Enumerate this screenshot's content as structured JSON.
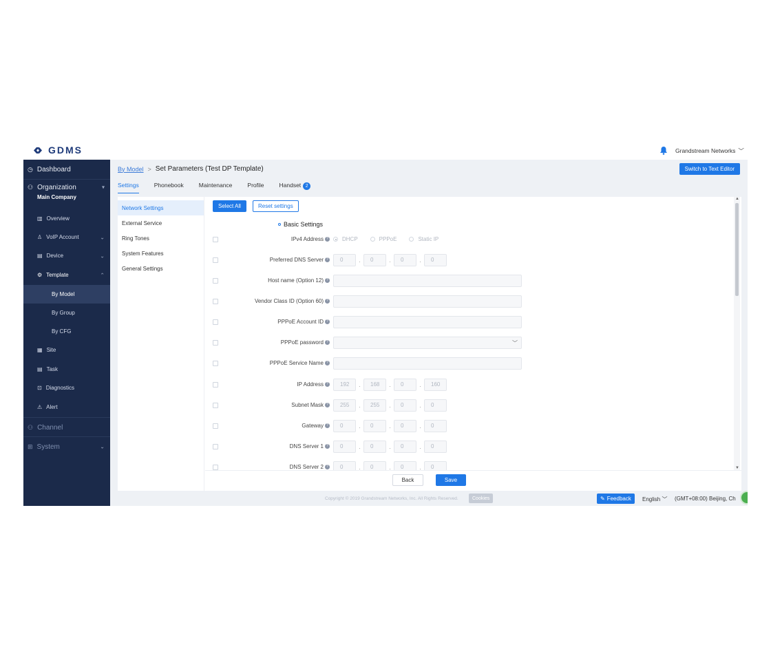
{
  "app": {
    "logo_text": "GDMS",
    "org_name": "Grandstream Networks"
  },
  "sidebar": {
    "dashboard": "Dashboard",
    "organization": "Organization",
    "company": "Main Company",
    "items": [
      "Overview",
      "VoIP Account",
      "Device",
      "Template"
    ],
    "template_children": [
      "By Model",
      "By Group",
      "By CFG"
    ],
    "items2": [
      "Site",
      "Task",
      "Diagnostics",
      "Alert"
    ],
    "channel": "Channel",
    "system": "System"
  },
  "breadcrumb": {
    "link": "By Model",
    "separator": ">",
    "title": "Set Parameters (Test DP Template)"
  },
  "header": {
    "switch_button": "Switch to Text Editor"
  },
  "tabs": [
    {
      "label": "Settings"
    },
    {
      "label": "Phonebook"
    },
    {
      "label": "Maintenance"
    },
    {
      "label": "Profile"
    },
    {
      "label": "Handset",
      "badge": "2"
    }
  ],
  "subnav": [
    "Network Settings",
    "External Service",
    "Ring Tones",
    "System Features",
    "General Settings"
  ],
  "content": {
    "select_all": "Select All",
    "reset": "Reset settings",
    "section_title": "Basic Settings",
    "ipv4_label": "IPv4 Address",
    "ipv4_options": [
      "DHCP",
      "PPPoE",
      "Static IP"
    ],
    "dns_label": "Preferred DNS Server",
    "dns_values": [
      "0",
      "0",
      "0",
      "0"
    ],
    "host_label": "Host name (Option 12)",
    "vendor_label": "Vendor Class ID (Option 60)",
    "pppoe_account_label": "PPPoE Account ID",
    "pppoe_password_label": "PPPoE password",
    "pppoe_service_label": "PPPoE Service Name",
    "ip_label": "IP Address",
    "ip_values": [
      "192",
      "168",
      "0",
      "160"
    ],
    "mask_label": "Subnet Mask",
    "mask_values": [
      "255",
      "255",
      "0",
      "0"
    ],
    "gateway_label": "Gateway",
    "gateway_values": [
      "0",
      "0",
      "0",
      "0"
    ],
    "dns1_label": "DNS Server 1",
    "dns1_values": [
      "0",
      "0",
      "0",
      "0"
    ],
    "dns2_label": "DNS Server 2",
    "dns2_values": [
      "0",
      "0",
      "0",
      "0"
    ]
  },
  "footer": {
    "back": "Back",
    "save": "Save",
    "copyright": "Copyright © 2019 Grandstream Networks, Inc. All Rights Reserved.",
    "cookies": "Cookies",
    "feedback": "Feedback",
    "language": "English",
    "timezone": "(GMT+08:00) Beijing, Ch"
  },
  "colors": {
    "primary": "#1f78e6",
    "sidebar": "#1b2a4a"
  }
}
